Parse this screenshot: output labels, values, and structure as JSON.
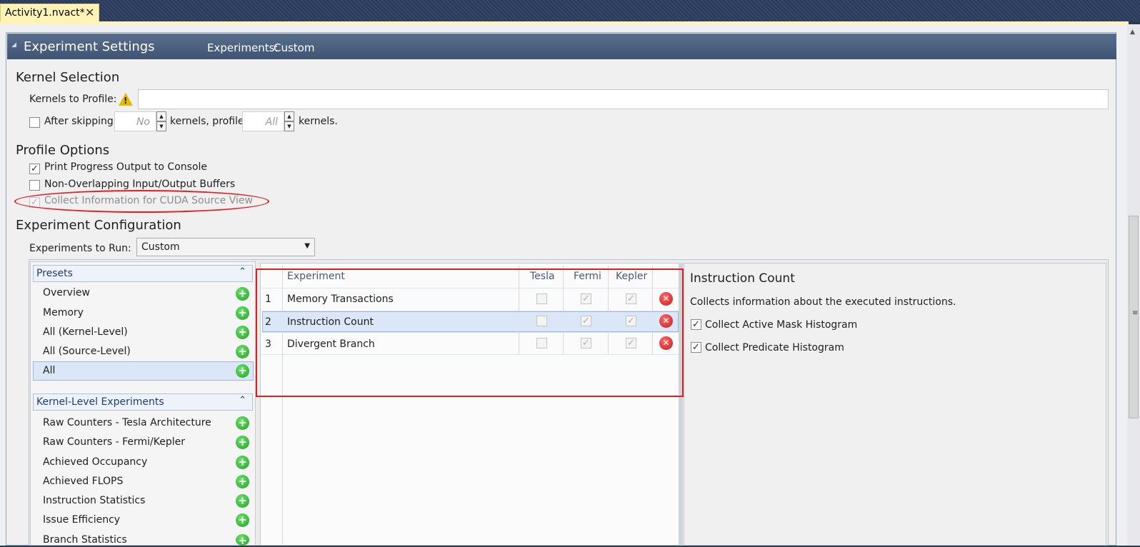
{
  "tab": {
    "title": "Activity1.nvact*",
    "close": "✕"
  },
  "header": {
    "title": "Experiment Settings",
    "experiments_label": "Experiments:",
    "experiments_value": "Custom"
  },
  "kernel_selection": {
    "title": "Kernel Selection",
    "kernels_label": "Kernels to Profile:",
    "kernels_value": "",
    "after_skipping": "After skipping",
    "skip_placeholder": "No",
    "kernels_profile": "kernels, profile",
    "profile_placeholder": "All",
    "kernels_end": "kernels."
  },
  "profile_options": {
    "title": "Profile Options",
    "print_progress": "Print Progress Output to Console",
    "non_overlapping": "Non-Overlapping Input/Output Buffers",
    "collect_cuda": "Collect Information for CUDA Source View"
  },
  "experiment_config": {
    "title": "Experiment Configuration",
    "run_label": "Experiments to Run:",
    "run_value": "Custom"
  },
  "presets": {
    "header": "Presets",
    "items": [
      "Overview",
      "Memory",
      "All (Kernel-Level)",
      "All (Source-Level)",
      "All"
    ]
  },
  "kernel_level": {
    "header": "Kernel-Level Experiments",
    "items": [
      "Raw Counters - Tesla Architecture",
      "Raw Counters - Fermi/Kepler",
      "Achieved Occupancy",
      "Achieved FLOPS",
      "Instruction Statistics",
      "Issue Efficiency",
      "Branch Statistics"
    ]
  },
  "experiment_table": {
    "columns": [
      "Experiment",
      "Tesla",
      "Fermi",
      "Kepler"
    ],
    "rows": [
      {
        "index": "1",
        "name": "Memory Transactions"
      },
      {
        "index": "2",
        "name": "Instruction Count"
      },
      {
        "index": "3",
        "name": "Divergent Branch"
      }
    ]
  },
  "details": {
    "title": "Instruction Count",
    "description": "Collects information about the executed instructions.",
    "opt1": "Collect Active Mask Histogram",
    "opt2": "Collect Predicate Histogram"
  },
  "icons": {
    "warning": "warning-icon",
    "add": "add-icon",
    "delete": "delete-icon"
  }
}
